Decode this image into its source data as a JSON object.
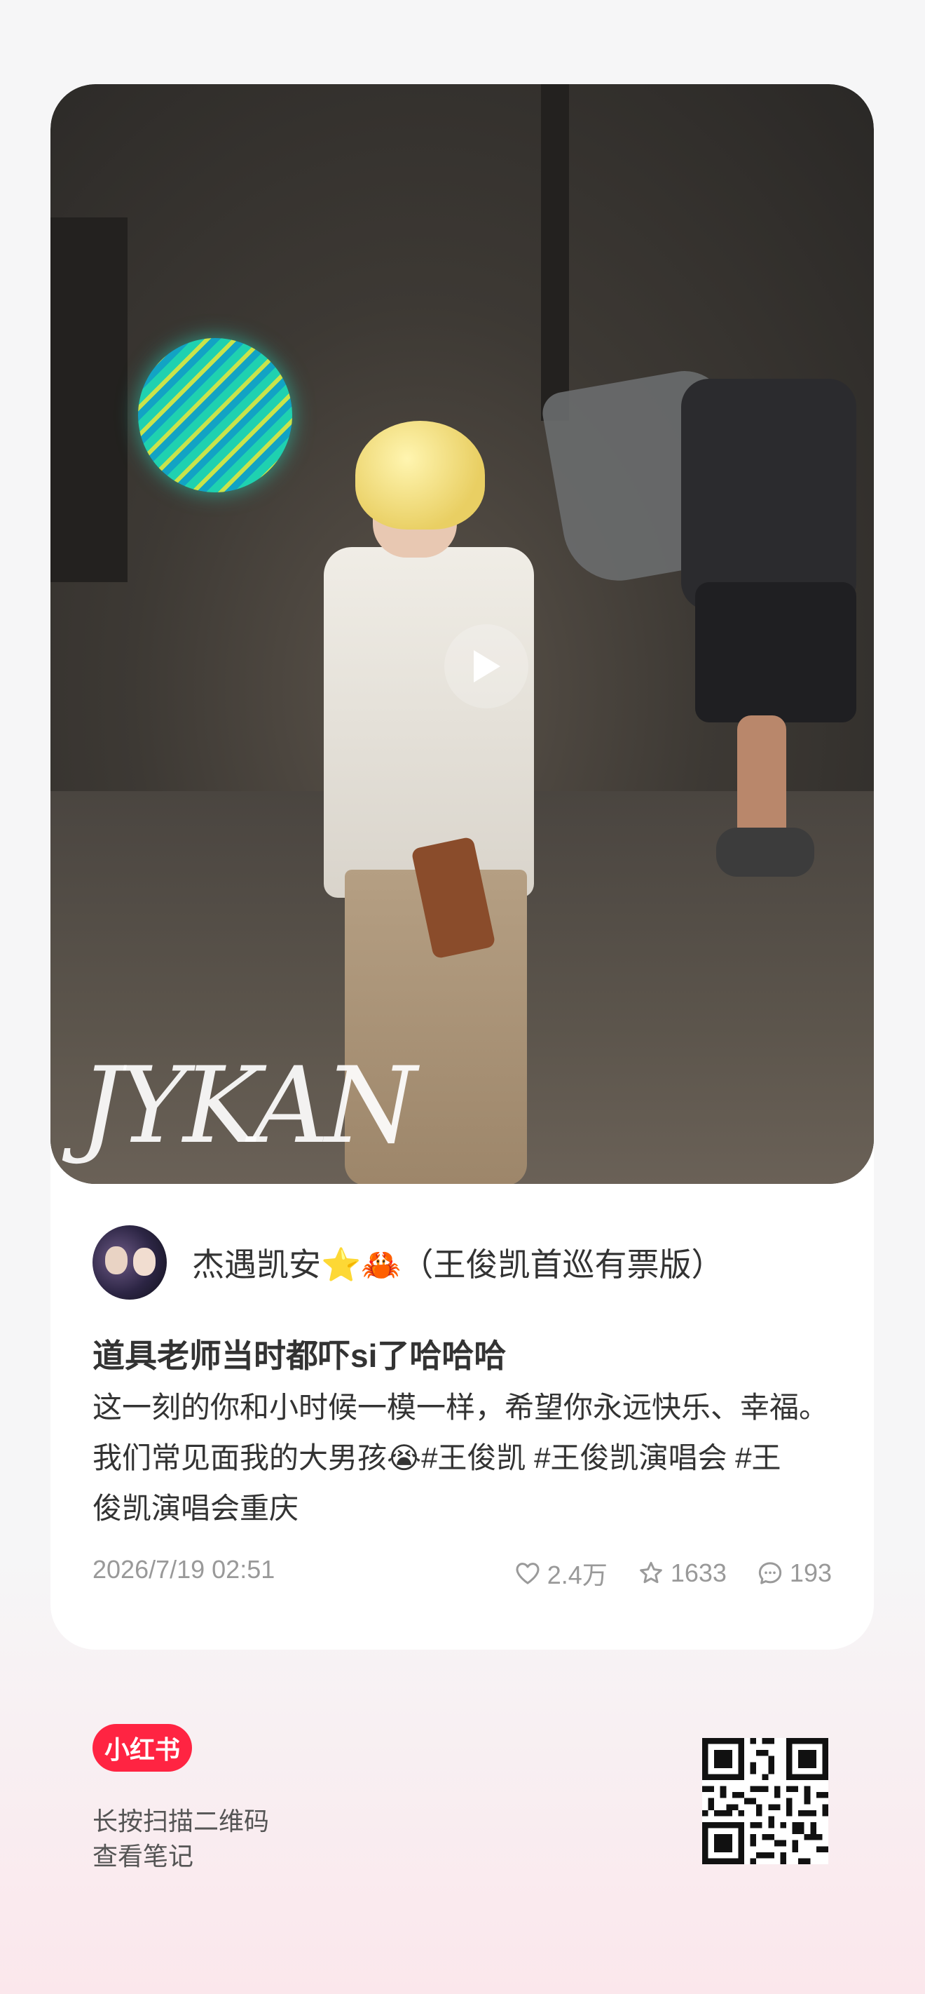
{
  "post": {
    "author": "杰遇凯安⭐🦀（王俊凯首巡有票版）",
    "title": "道具老师当时都吓si了哈哈哈",
    "description_lines": [
      "这一刻的你和小时候一模一样，希望你永远快乐、幸福。",
      "我们常见面我的大男孩😭#王俊凯  #王俊凯演唱会  #王",
      "俊凯演唱会重庆"
    ],
    "date": "2026/7/19 02:51",
    "likes": "2.4万",
    "collects": "1633",
    "comments": "193",
    "watermark": "JYKAN"
  },
  "footer": {
    "brand": "小红书",
    "hint_line1": "长按扫描二维码",
    "hint_line2": "查看笔记"
  },
  "icons": {
    "play": "play-icon",
    "like": "heart-icon",
    "collect": "star-icon",
    "comment": "comment-icon",
    "qr": "qr-code-icon"
  },
  "colors": {
    "brand": "#ff2442",
    "meta_text": "#999999"
  }
}
